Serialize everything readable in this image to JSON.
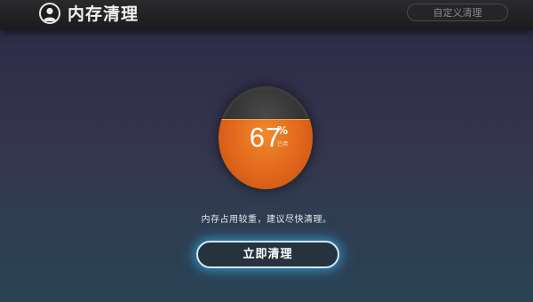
{
  "header": {
    "title": "内存清理",
    "custom_clean_label": "自定义清理",
    "icon": "user-avatar-icon"
  },
  "gauge": {
    "value": "67",
    "unit": "%",
    "sub_label": "已用",
    "usage_fraction": 0.67,
    "fill_color": "#e0661b"
  },
  "status": {
    "message": "内存占用较重，建议尽快清理。"
  },
  "action": {
    "clean_now_label": "立即清理",
    "glow_color": "#3caadc"
  }
}
